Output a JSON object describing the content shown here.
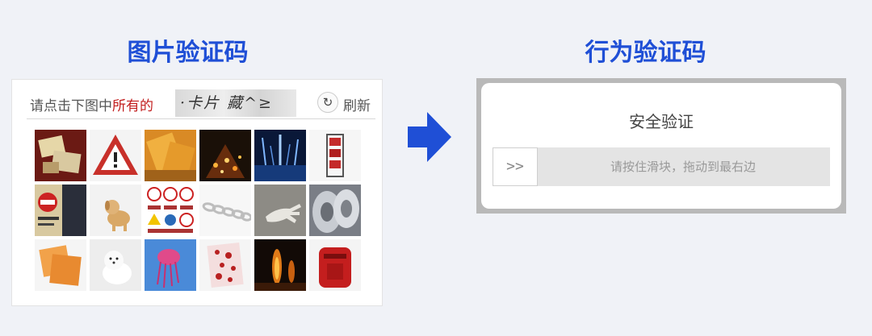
{
  "left_heading": "图片验证码",
  "right_heading": "行为验证码",
  "image_captcha": {
    "instruction_prefix": "请点击下图中",
    "instruction_highlight": "所有的",
    "captcha_text": "·卡片 藏^≥",
    "refresh_label": "刷新",
    "accent_color": "#c21e1e"
  },
  "behavior_captcha": {
    "title": "安全验证",
    "handle_glyph": ">>",
    "hint": "请按住滑块，拖动到最右边"
  },
  "arrow_color": "#1f4fd6",
  "heading_color": "#1f4fd6"
}
